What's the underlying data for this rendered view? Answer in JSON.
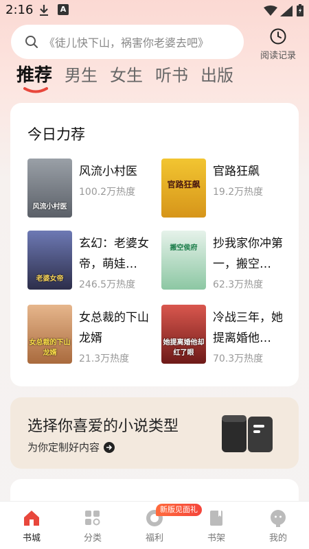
{
  "status": {
    "time": "2:16"
  },
  "search": {
    "placeholder": "《徒儿快下山，祸害你老婆去吧》"
  },
  "history": {
    "label": "阅读记录"
  },
  "tabs": [
    {
      "label": "推荐"
    },
    {
      "label": "男生"
    },
    {
      "label": "女生"
    },
    {
      "label": "听书"
    },
    {
      "label": "出版"
    }
  ],
  "recommend": {
    "title": "今日力荐",
    "books": [
      {
        "title": "风流小村医",
        "heat": "100.2万热度",
        "cover_text": "风流小村医",
        "cover_color": "#7a7f86"
      },
      {
        "title": "官路狂飙",
        "heat": "19.2万热度",
        "cover_text": "官路狂飙",
        "cover_color": "#e8b62a"
      },
      {
        "title": "玄幻：老婆女帝，萌娃…",
        "heat": "246.5万热度",
        "cover_text": "老婆女帝",
        "cover_color": "#3b3f63"
      },
      {
        "title": "抄我家你冲第一，搬空…",
        "heat": "62.3万热度",
        "cover_text": "搬空侯府",
        "cover_color": "#9fd3b0"
      },
      {
        "title": "女总裁的下山龙婿",
        "heat": "21.3万热度",
        "cover_text": "女总裁的下山龙婿",
        "cover_color": "#c98a5b"
      },
      {
        "title": "冷战三年，她提离婚他…",
        "heat": "70.3万热度",
        "cover_text": "她提离婚他却红了眼",
        "cover_color": "#a8302c"
      }
    ]
  },
  "genre": {
    "title": "选择你喜爱的小说类型",
    "subtitle": "为你定制好内容"
  },
  "nav": {
    "items": [
      {
        "label": "书城"
      },
      {
        "label": "分类"
      },
      {
        "label": "福利"
      },
      {
        "label": "书架"
      },
      {
        "label": "我的"
      }
    ],
    "badge": "新版见面礼"
  },
  "colors": {
    "accent": "#e8473c",
    "banner": "#f3e9de"
  }
}
